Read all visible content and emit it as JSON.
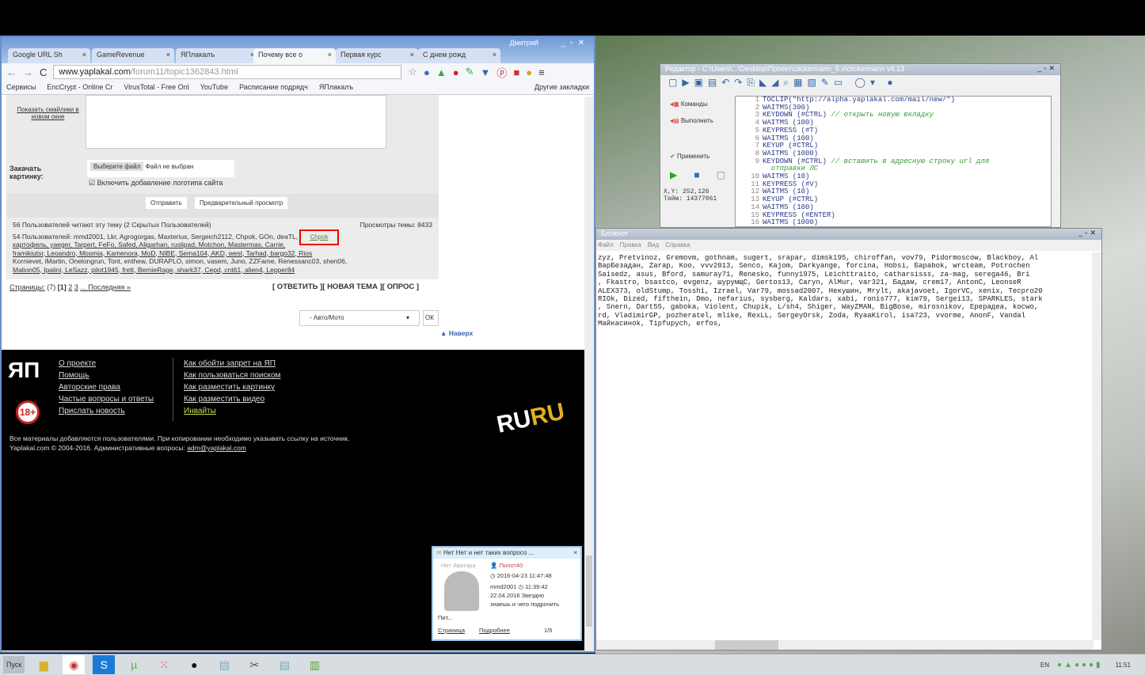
{
  "browser": {
    "user": "Дмитрий",
    "tabs": [
      {
        "label": "Google URL Sh"
      },
      {
        "label": "GameRevenue"
      },
      {
        "label": "ЯПлакалъ"
      },
      {
        "label": "Почему все о"
      },
      {
        "label": "Первая курс"
      },
      {
        "label": "С днем рожд"
      }
    ],
    "url_host": "www.yaplakal.com",
    "url_path": "/forum11/topic1362843.html",
    "bookmarks": [
      "Сервисы",
      "EncCrypt - Online Cr",
      "VirusTotal - Free Onl",
      "YouTube",
      "Расписание подрядч",
      "ЯПлакалъ",
      "Другие закладки"
    ]
  },
  "form": {
    "show_smilies": "Показать смайлики в новом окне",
    "upload_label": "Закачать картинку:",
    "choose_file": "Выберите файл",
    "no_file": "Файл не выбран",
    "watermark": "Включить добавление логотипа сайта",
    "send": "Отправить",
    "preview": "Предварительный просмотр"
  },
  "readers": {
    "summary": "56 Пользователей читают эту тему (2 Скрытых Пользователей)",
    "views": "Просмотры темы: 8433",
    "users_line": "54 Пользователей: mmd2001, Lkr, Agrogorgas, Maxterius, Sergeich2112, Chpok, GOn, deaTL, max777,",
    "users_more": [
      "картофель, yaeger, Tarpert, FeFo, Safed, Aligarhan, ruslipad, Motchon, Mastermas, Carrie,",
      "framikiutsr, Leoandro, Mosmia, Kamenora, MoD, NIBE, Sema104, AKD, west, Tarhad, bargo32, Rios",
      "Kornievet, iMartin, Onelongrun, Tont, enthew, DURAPLO, simon, vasem, Juno, ZZFame, Renessanc03, shen06,",
      "Malion05, Ipalini, LeSazz, pilot1945, frett, BernieRage, shark37, Cepd, cnt61, alien4, Lepper84"
    ],
    "highlighted_user": "Chpok"
  },
  "pagination": {
    "label": "Страницы:",
    "total": "(7)",
    "current": "[1]",
    "pages": [
      "2",
      "3"
    ],
    "last": "... Последняя »"
  },
  "actions": {
    "reply": "[ ОТВЕТИТЬ ]",
    "new_topic": "[ НОВАЯ ТЕМА ]",
    "poll": "[ ОПРОС ]"
  },
  "jump": {
    "select": "- Авто/Мото",
    "go": "ОК",
    "top": "▲ Наверх"
  },
  "footer": {
    "col1": [
      "О проекте",
      "Помощь",
      "Авторские права",
      "Частые вопросы и ответы",
      "Прислать новость"
    ],
    "col2": [
      "Как обойти запрет на ЯП",
      "Как пользоваться поиском",
      "Как разместить картинку",
      "Как разместить видео",
      "Инвайты"
    ],
    "age": "18+",
    "logo": "ЯП",
    "ruru": "RU RU",
    "notice": "Все материалы добавляются пользователями. При копировании необходимо указывать ссылку на источник.",
    "copyright": "Yaplakal.com © 2004-2016. Административные вопросы:",
    "email": "adm@yaplakal.com"
  },
  "popup": {
    "title": "Нет Нет и нет таких вопросо ...",
    "no_avatar": "Нет Аватара",
    "user": "Пилот40",
    "date": "2016-04-23 11:47:48",
    "author": "mmd2001",
    "time": "11:39:42",
    "date2": "22.04.2016",
    "text1": "Звездно",
    "text2": "знаешь и чего подрочить",
    "more": "Пит...",
    "link1": "Страница",
    "link2": "Подробнее",
    "counter": "1/5"
  },
  "editor": {
    "title": "Редактор - C:\\Users\\...\\Desktop\\Проект\\clickermann_5.x\\clickermann v4.13",
    "side": [
      "Команды",
      "Выполнить",
      "Применить"
    ],
    "coords": "X,Y: 252,126",
    "timer": "Тайм: 14377061",
    "lines": [
      {
        "n": "1",
        "code": "TOCLIP(\"http://alpha.yaplakal.com/mail/new/\")",
        "comment": ""
      },
      {
        "n": "2",
        "code": "WAITMS(300)",
        "comment": ""
      },
      {
        "n": "3",
        "code": "KEYDOWN (#CTRL)",
        "comment": "// открыть новую вкладку"
      },
      {
        "n": "4",
        "code": "WAITMS (100)",
        "comment": ""
      },
      {
        "n": "5",
        "code": "KEYPRESS (#T)",
        "comment": ""
      },
      {
        "n": "6",
        "code": "WAITMS (100)",
        "comment": ""
      },
      {
        "n": "7",
        "code": "KEYUP (#CTRL)",
        "comment": ""
      },
      {
        "n": "8",
        "code": "WAITMS (1000)",
        "comment": ""
      },
      {
        "n": "9",
        "code": "KEYDOWN (#CTRL)",
        "comment": "// вставить в адресную строку url для"
      },
      {
        "n": "",
        "code": "",
        "comment": " отправки ЛС"
      },
      {
        "n": "10",
        "code": "WAITMS (10)",
        "comment": ""
      },
      {
        "n": "11",
        "code": "KEYPRESS (#V)",
        "comment": ""
      },
      {
        "n": "12",
        "code": "WAITMS (10)",
        "comment": ""
      },
      {
        "n": "13",
        "code": "KEYUP (#CTRL)",
        "comment": ""
      },
      {
        "n": "14",
        "code": "WAITMS (100)",
        "comment": ""
      },
      {
        "n": "15",
        "code": "KEYPRESS (#ENTER)",
        "comment": ""
      },
      {
        "n": "16",
        "code": "WAITMS (1000)",
        "comment": ""
      }
    ]
  },
  "notepad": {
    "title": "Блокнот",
    "menu": [
      "Файл",
      "Правка",
      "Вид",
      "Справка"
    ],
    "lines": [
      "zyz, Pretvinoz, Gremovm, gothnam, sugert, srapar, dimsk195, chiroffan, vov79, Pidormoscow, Blackboy, Al",
      "ВарБезадан, Zarap, Koo, vvv2013, Senco, Kajom, Darkyange, forcina, Hobsi, Бараbok, wrcteam, Potrochen",
      "Saisedz, asus, Bford, samuray71, Renesko, funny1975, Leichttraito, catharsisss, za-mag, serega46, Bri",
      ", Fkastro, bsastco, evgenz, шурумщC, Gertos13, Caryn, AlMur, var321, Бадам, crem17, AntonC, LeonseR",
      "ALEX373, oldStump, Tosshi, Izrael, Var79, mossad2007, Некушин, Mrylt, akajavoet, IgorVC, xenix, Tecpro20",
      "RIOk, Dized, fifthein, Dmo, nefarius, sysberg, Kaldars, xabi, ronis777, kim79, Sergei13, SPARKLES, stark",
      ", Snern, Dart55, gaboka, Violent, Chupik, L/sh4, Shiger, WayZMAN, BigBose, mirosnikov, Ерерадеа, kocwo,",
      "rd, VladimirGP, pozheratel, mlike, RexLL, SergeyOrsk, Zoda, RyaaKirol, isa723, vvorme, AnonF, Vandal",
      "Майкасиноk, Tipfupych, erfos,"
    ]
  },
  "taskbar": {
    "start": "Пуск",
    "lang": "EN",
    "clock": "11:51"
  }
}
